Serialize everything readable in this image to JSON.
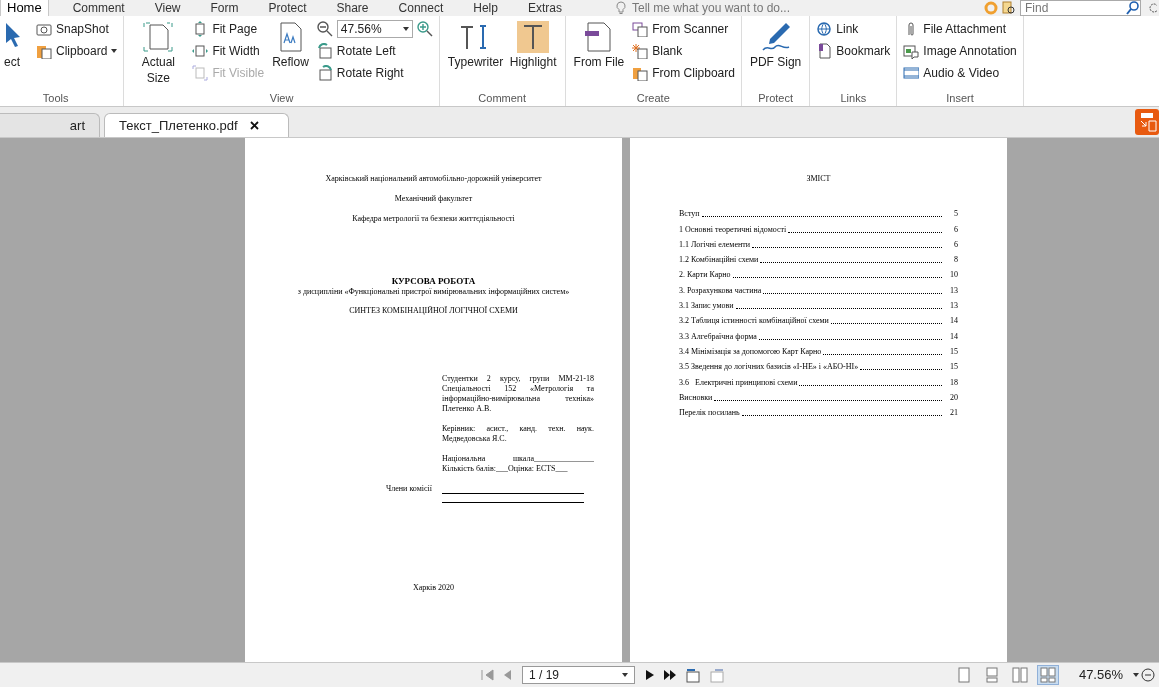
{
  "menu_tabs": [
    {
      "label": "Home",
      "selected": true
    },
    {
      "label": "Comment",
      "selected": false
    },
    {
      "label": "View",
      "selected": false
    },
    {
      "label": "Form",
      "selected": false
    },
    {
      "label": "Protect",
      "selected": false
    },
    {
      "label": "Share",
      "selected": false
    },
    {
      "label": "Connect",
      "selected": false
    },
    {
      "label": "Help",
      "selected": false
    },
    {
      "label": "Extras",
      "selected": false
    }
  ],
  "tell_me": {
    "placeholder": "Tell me what you want to do..."
  },
  "find": {
    "placeholder": "Find"
  },
  "ribbon_groups": [
    {
      "label": "Tools",
      "items": [
        {
          "kind": "large",
          "label": "ect",
          "disabled": false
        },
        {
          "kind": "small",
          "label": "SnapShot",
          "disabled": false
        },
        {
          "kind": "small",
          "label": "Clipboard",
          "disabled": false,
          "dropdown": true
        }
      ]
    },
    {
      "label": "View",
      "items": [
        {
          "kind": "large",
          "label": "Actual Size",
          "disabled": false
        },
        {
          "kind": "small",
          "label": "Fit Page",
          "disabled": false
        },
        {
          "kind": "small",
          "label": "Fit Width",
          "disabled": false
        },
        {
          "kind": "small",
          "label": "Fit Visible",
          "disabled": true
        },
        {
          "kind": "large",
          "label": "Reflow",
          "disabled": false
        },
        {
          "kind": "zoom",
          "value": "47.56%"
        },
        {
          "kind": "small",
          "label": "Rotate Left",
          "disabled": false
        },
        {
          "kind": "small",
          "label": "Rotate Right",
          "disabled": false
        }
      ]
    },
    {
      "label": "Comment",
      "items": [
        {
          "kind": "large",
          "label": "Typewriter",
          "disabled": false
        },
        {
          "kind": "large",
          "label": "Highlight",
          "disabled": false,
          "selected": true
        }
      ]
    },
    {
      "label": "Create",
      "items": [
        {
          "kind": "large",
          "label": "From File",
          "disabled": false
        },
        {
          "kind": "small",
          "label": "From Scanner",
          "disabled": false
        },
        {
          "kind": "small",
          "label": "Blank",
          "disabled": false
        },
        {
          "kind": "small",
          "label": "From Clipboard",
          "disabled": false
        }
      ]
    },
    {
      "label": "Protect",
      "items": [
        {
          "kind": "large",
          "label": "PDF Sign",
          "disabled": false
        }
      ]
    },
    {
      "label": "Links",
      "items": [
        {
          "kind": "small",
          "label": "Link",
          "disabled": false
        },
        {
          "kind": "small",
          "label": "Bookmark",
          "disabled": false
        }
      ]
    },
    {
      "label": "Insert",
      "items": [
        {
          "kind": "small",
          "label": "File Attachment",
          "disabled": false
        },
        {
          "kind": "small",
          "label": "Image Annotation",
          "disabled": false
        },
        {
          "kind": "small",
          "label": "Audio & Video",
          "disabled": false
        }
      ]
    }
  ],
  "doc_tabs": [
    {
      "label": "art",
      "selected": false
    },
    {
      "label": "Текст_Плетенко.pdf",
      "selected": true
    }
  ],
  "title_page": {
    "lines": [
      {
        "kind": "center",
        "text": "Харківський національний автомобільно-дорожній університет"
      },
      {
        "kind": "center",
        "text": "Механічний факультет"
      },
      {
        "kind": "center",
        "text": "Кафедра метрології та безпеки життєдіяльності"
      },
      {
        "kind": "title",
        "text": "КУРСОВА РОБОТА"
      },
      {
        "kind": "center",
        "text": "з дисципліни «Функціональні пристрої вимірювальних інформаційних систем»"
      },
      {
        "kind": "subtitle",
        "text": "СИНТЕЗ КОМБІНАЦІЙНОЇ ЛОГІЧНОЇ СХЕМИ"
      },
      {
        "kind": "block",
        "text": "Студентки 2 курсу, групи ММ-21-18 Спеціальності 152 «Метрологія та інформаційно-вимірювальна техніка» Плетенко А.В."
      },
      {
        "kind": "block",
        "text": "Керівник: асист., канд. техн. наук. Медведовська Я.С."
      },
      {
        "kind": "block",
        "text": "Національна шкала_______________ Кількість балів:___Оцінка: ECTS___"
      },
      {
        "kind": "signature",
        "text": "Члени комісії"
      },
      {
        "kind": "footer",
        "text": "Харків 2020"
      }
    ]
  },
  "contents_page": {
    "title": "ЗМІСТ",
    "entries": [
      {
        "title": "Вступ",
        "page": "5"
      },
      {
        "title": "1 Основні теоретичні відомості",
        "page": "6"
      },
      {
        "title": "1.1 Логічні елементи",
        "page": "6"
      },
      {
        "title": "1.2 Комбінаційні схеми",
        "page": "8"
      },
      {
        "title": "2. Карти Карно",
        "page": "10"
      },
      {
        "title": "3. Розрахункова частина",
        "page": "13"
      },
      {
        "title": "3.1 Запис умови",
        "page": "13"
      },
      {
        "title": "3.2 Таблиця істинності комбінаційної схеми",
        "page": "14"
      },
      {
        "title": "3.3 Алгебраїчна форма",
        "page": "14"
      },
      {
        "title": "3.4 Мінімізація за допомогою Карт Карно",
        "page": "15"
      },
      {
        "title": "3.5 Зведення до логічних базисів «І-НЕ» і «АБО-НІ»",
        "page": "15"
      },
      {
        "title": "3.6   Електричні принципові схеми",
        "page": "18"
      },
      {
        "title": "Висновки",
        "page": "20"
      },
      {
        "title": "Перелік посилань",
        "page": "21"
      }
    ]
  },
  "status_bar": {
    "page_field": "1 / 19",
    "zoom": "47.56%",
    "view_modes": [
      {
        "selected": false
      },
      {
        "selected": false
      },
      {
        "selected": false
      },
      {
        "selected": true
      }
    ]
  }
}
